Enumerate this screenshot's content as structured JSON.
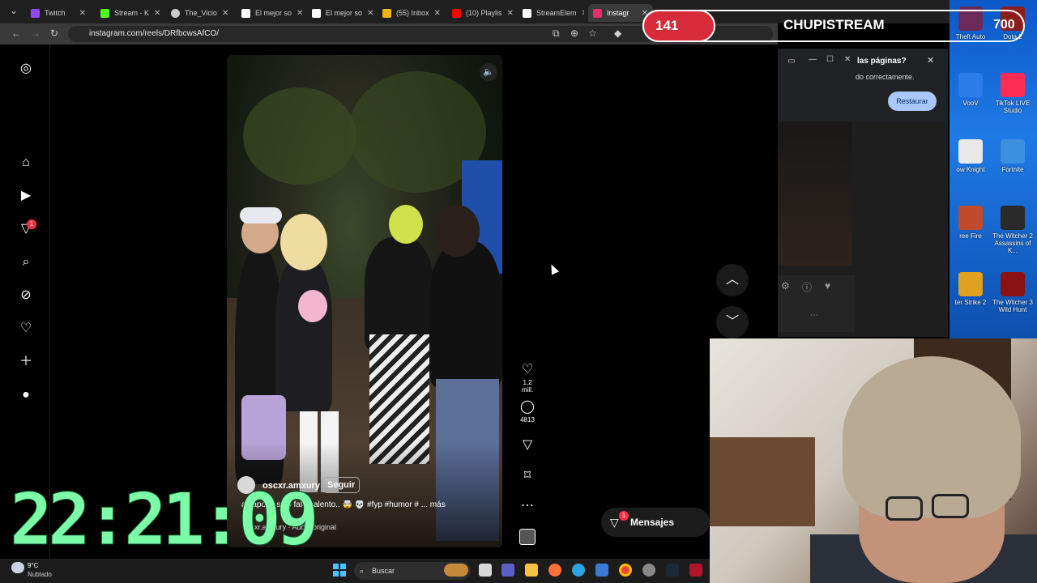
{
  "browser": {
    "tabs": [
      {
        "label": "Twitch",
        "color": "#9146ff"
      },
      {
        "label": "Stream - K",
        "color": "#53fc18"
      },
      {
        "label": "The_Vicio",
        "color": "#cccccc"
      },
      {
        "label": "El mejor so",
        "color": "#ffffff"
      },
      {
        "label": "El mejor so",
        "color": "#ffffff"
      },
      {
        "label": "(55) Inbox",
        "color": "#f4b400"
      },
      {
        "label": "(10) Playlis",
        "color": "#ff0000"
      },
      {
        "label": "StreamElem",
        "color": "#ffffff"
      },
      {
        "label": "Instagr",
        "color": "#e1306c"
      }
    ],
    "url": "instagram.com/reels/DRfbcwsAfCO/"
  },
  "sidebar": {
    "notif_badge": "1"
  },
  "reel": {
    "author": "oscxr.amxury",
    "follow_label": "Seguir",
    "caption": "ay apoyo solo falto talento.. 🤯 💀 #fyp #humor # ... más",
    "audio": "oscxr.amxury · Audio original",
    "likes": "1,2 mill.",
    "comments": "4813"
  },
  "messages": {
    "label": "Mensajes",
    "badge": "1"
  },
  "overlay": {
    "clock": "22:21:09",
    "counter_left": "141",
    "channel": "CHUPISTREAM",
    "counter_right": "700"
  },
  "restore_popup": {
    "title": "las páginas?",
    "text": "do correctamente.",
    "button": "Restaurar"
  },
  "desktop_icons": [
    {
      "label": "Theft Auto"
    },
    {
      "label": "Dota 2"
    },
    {
      "label": "VooV"
    },
    {
      "label": "TikTok LIVE Studio"
    },
    {
      "label": "ow Knight"
    },
    {
      "label": "Fortnite"
    },
    {
      "label": "ree Fire"
    },
    {
      "label": "The Witcher 2 Assassins of K..."
    },
    {
      "label": "ter Strike 2"
    },
    {
      "label": "The Witcher 3 Wild Hunt"
    }
  ],
  "taskbar": {
    "temp": "9°C",
    "weather": "Nublado",
    "search": "Buscar"
  }
}
